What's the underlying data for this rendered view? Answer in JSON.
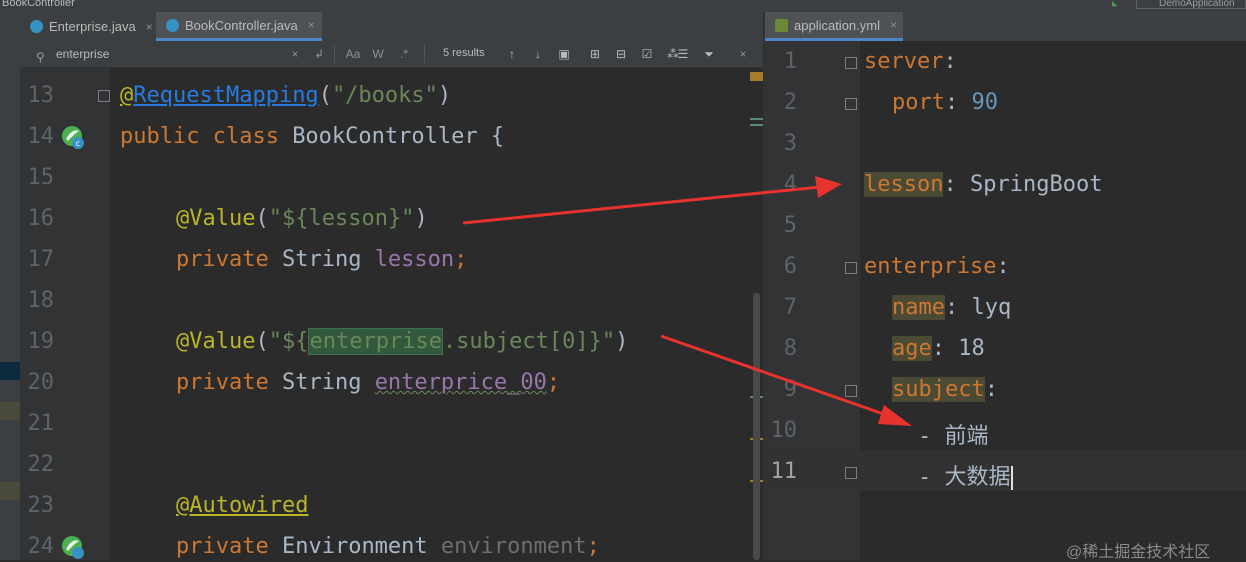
{
  "window": {
    "title": "BookController",
    "run_config": "DemoApplication"
  },
  "left_tabs": [
    {
      "label": "Enterprise.java",
      "close": "×",
      "active": false
    },
    {
      "label": "BookController.java",
      "close": "×",
      "active": true
    }
  ],
  "right_tabs": [
    {
      "label": "application.yml",
      "close": "×",
      "active": true
    }
  ],
  "search": {
    "value": "enterprise",
    "results": "5 results",
    "case_label": "Aa",
    "word_label": "W",
    "regex_label": ".*"
  },
  "left_editor": {
    "line_numbers": [
      "13",
      "14",
      "15",
      "16",
      "17",
      "18",
      "19",
      "20",
      "21",
      "22",
      "23",
      "24"
    ],
    "lines": {
      "l13_ann": "@",
      "l13_name": "RequestMapping",
      "l13_p1": "(",
      "l13_str": "\"/books\"",
      "l13_p2": ")",
      "l14_kw": "public class ",
      "l14_rest": "BookController {",
      "l16_ann": "@Value",
      "l16_p1": "(",
      "l16_str": "\"${lesson}\"",
      "l16_p2": ")",
      "l17_kw": "private ",
      "l17_type": "String ",
      "l17_field": "lesson",
      "l17_semi": ";",
      "l19_ann": "@Value",
      "l19_p1": "(",
      "l19_s1": "\"${",
      "l19_hl": "enterprise",
      "l19_s2": ".subject[0]}\"",
      "l19_p2": ")",
      "l20_kw": "private ",
      "l20_type": "String ",
      "l20_field": "enterprice_00",
      "l20_semi": ";",
      "l23_ann": "@Autowired",
      "l24_kw": "private ",
      "l24_type": "Environment ",
      "l24_field": "environment",
      "l24_semi": ";"
    }
  },
  "right_editor": {
    "line_numbers": [
      "1",
      "2",
      "3",
      "4",
      "5",
      "6",
      "7",
      "8",
      "9",
      "10",
      "11"
    ],
    "lines": {
      "y1_key": "server",
      "y1_colon": ":",
      "y2_key": "port",
      "y2_colon": ": ",
      "y2_val": "90",
      "y4_key": "lesson",
      "y4_colon": ": ",
      "y4_val": "SpringBoot",
      "y6_key": "enterprise",
      "y6_colon": ":",
      "y7_key": "name",
      "y7_colon": ": ",
      "y7_val": "lyq",
      "y8_key": "age",
      "y8_colon": ": ",
      "y8_val": "18",
      "y9_key": "subject",
      "y9_colon": ":",
      "y10_val": "- 前端",
      "y11_val": "- 大数据"
    }
  },
  "watermark": "@稀土掘金技术社区",
  "colors": {
    "keyword": "#cc7832",
    "annotation": "#bbb529",
    "string": "#6a8759",
    "field": "#9876aa",
    "number": "#6897bb",
    "arrow": "#e8322e"
  }
}
